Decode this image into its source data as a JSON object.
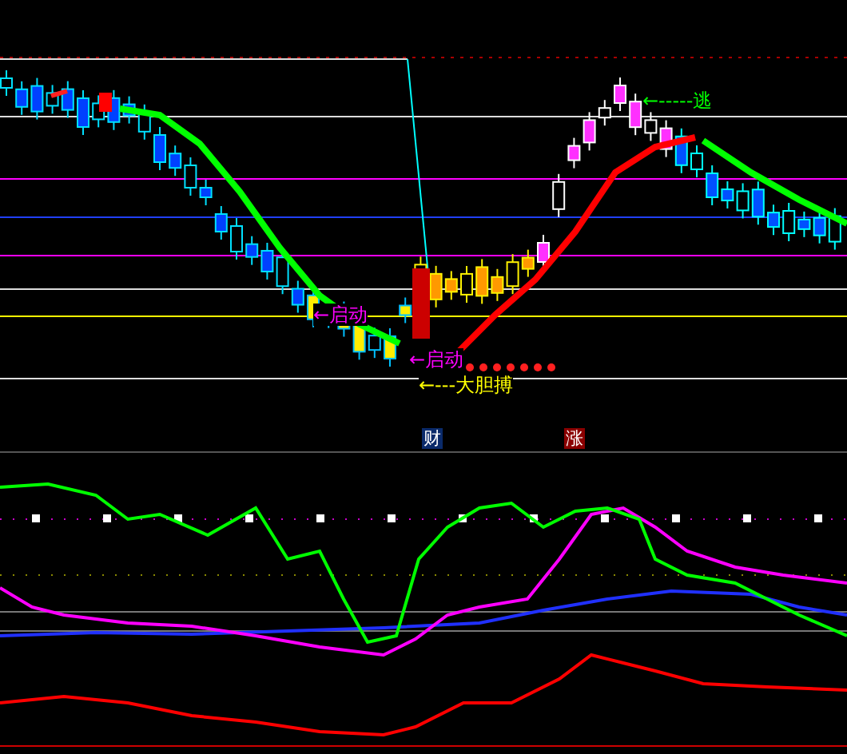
{
  "annotations": [
    {
      "text": "←启动",
      "color": "#ff00ff"
    },
    {
      "text": "←启动",
      "color": "#ff00ff"
    },
    {
      "text": "←---大胆搏",
      "color": "#ffff00"
    },
    {
      "text": "←-----逃",
      "color": "#00ff00"
    }
  ],
  "badges": [
    {
      "text": "财",
      "color": "#0a2a6a"
    },
    {
      "text": "涨",
      "color": "#8a0000"
    }
  ]
}
